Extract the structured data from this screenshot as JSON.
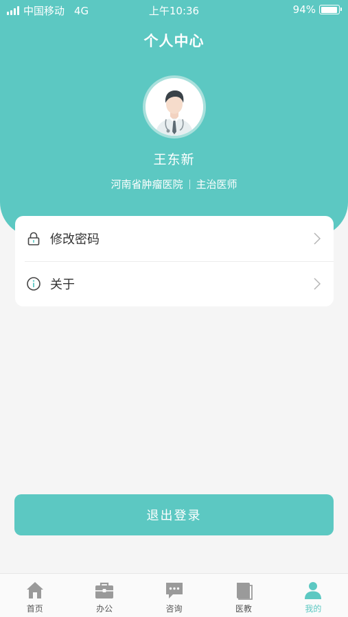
{
  "status_bar": {
    "carrier": "中国移动",
    "network": "4G",
    "time": "上午10:36",
    "battery": "94%",
    "battery_level": 0.94
  },
  "header": {
    "title": "个人中心"
  },
  "profile": {
    "name": "王东新",
    "hospital": "河南省肿瘤医院",
    "position": "主治医师",
    "avatar_icon": "doctor-avatar-icon"
  },
  "menu": {
    "items": [
      {
        "label": "修改密码",
        "icon": "lock-icon"
      },
      {
        "label": "关于",
        "icon": "info-icon"
      }
    ]
  },
  "logout": {
    "label": "退出登录"
  },
  "tabbar": {
    "items": [
      {
        "label": "首页",
        "icon": "home-icon",
        "active": false
      },
      {
        "label": "办公",
        "icon": "briefcase-icon",
        "active": false
      },
      {
        "label": "咨询",
        "icon": "chat-icon",
        "active": false
      },
      {
        "label": "医教",
        "icon": "book-icon",
        "active": false
      },
      {
        "label": "我的",
        "icon": "person-icon",
        "active": true
      }
    ]
  },
  "colors": {
    "primary": "#5cc8c2",
    "background": "#f5f5f5",
    "inactive_icon": "#9a9a9a"
  }
}
